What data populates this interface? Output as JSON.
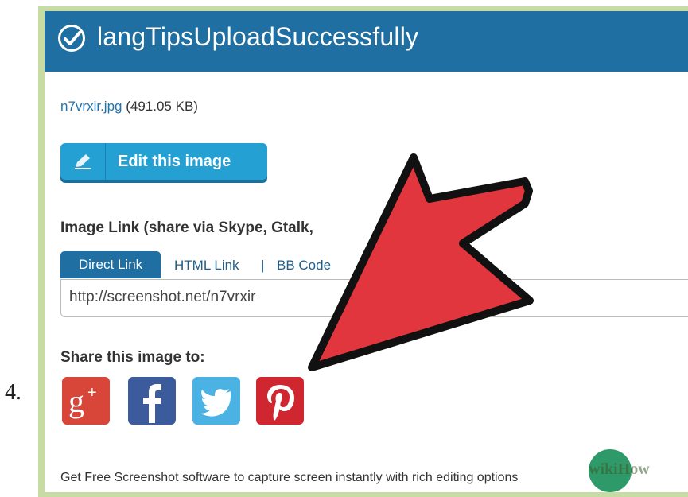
{
  "step_number": "4.",
  "header": {
    "title": "langTipsUploadSuccessfully"
  },
  "file": {
    "name": "n7vrxir.jpg",
    "size": "(491.05 KB)"
  },
  "edit_button": {
    "label": "Edit this image"
  },
  "image_link": {
    "heading": "Image Link (share via Skype, Gtalk,",
    "tabs": [
      "Direct Link",
      "HTML Link",
      "BB Code"
    ],
    "separator": "|",
    "url": "http://screenshot.net/n7vrxir"
  },
  "share": {
    "heading": "Share this image to:",
    "services": [
      "google-plus",
      "facebook",
      "twitter",
      "pinterest"
    ]
  },
  "footer": {
    "text": "Get Free Screenshot software to capture screen instantly with rich editing options"
  },
  "watermark": {
    "text": "wikiHow"
  },
  "colors": {
    "header_blue": "#1f6fa3",
    "button_blue": "#24a0d3",
    "frame_green": "#c7dca2",
    "arrow_red": "#e2363f",
    "gplus_red": "#d8463a",
    "facebook_blue": "#3b5b9c",
    "twitter_blue": "#4bb2e4",
    "pinterest_red": "#d0262f"
  }
}
